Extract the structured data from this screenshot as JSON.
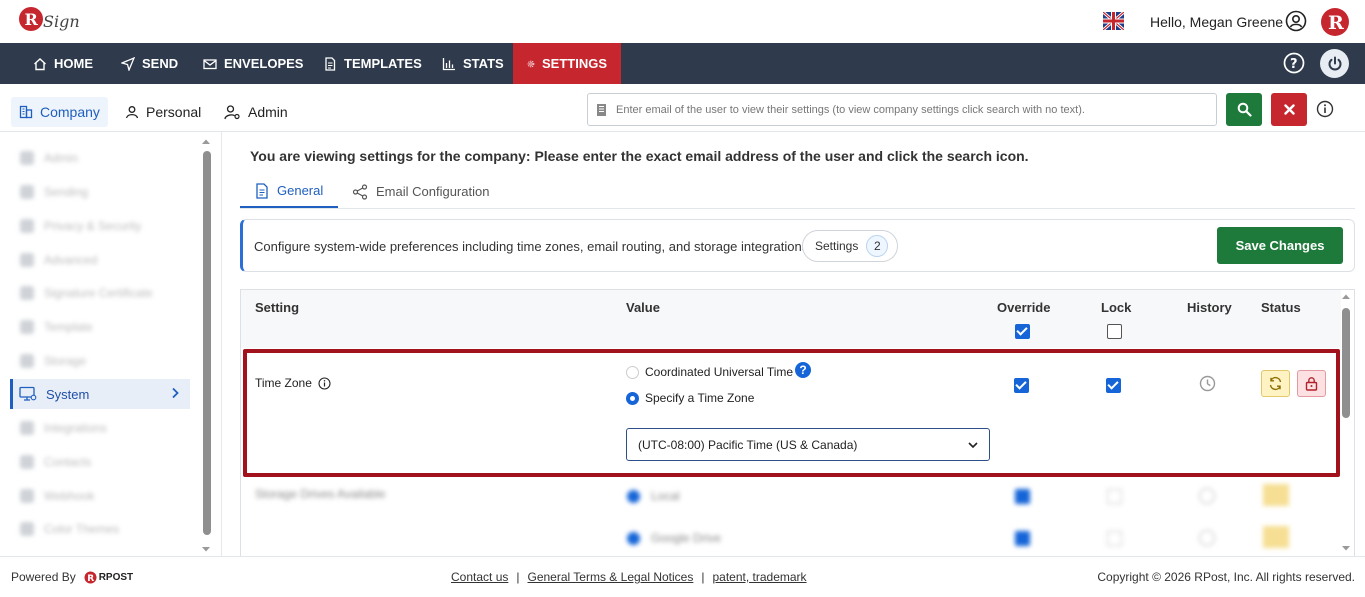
{
  "header": {
    "greeting": "Hello, Megan Greene",
    "brand_color": "#c6262e"
  },
  "nav": {
    "items": [
      {
        "label": "HOME",
        "icon": "home-icon"
      },
      {
        "label": "SEND",
        "icon": "send-icon"
      },
      {
        "label": "ENVELOPES",
        "icon": "envelope-icon"
      },
      {
        "label": "TEMPLATES",
        "icon": "document-icon"
      },
      {
        "label": "STATS",
        "icon": "bar-chart-icon"
      },
      {
        "label": "SETTINGS",
        "icon": "gear-icon",
        "active": true
      }
    ]
  },
  "subnav": {
    "tabs": [
      {
        "label": "Company",
        "active": true
      },
      {
        "label": "Personal"
      },
      {
        "label": "Admin"
      }
    ],
    "search_placeholder": "Enter email of the user to view their settings (to view company settings click search with no text)."
  },
  "sidebar": {
    "active_item": "System"
  },
  "main": {
    "notice": "You are viewing settings for the company: Please enter the exact email address of the user and click the search icon.",
    "tabs": [
      {
        "label": "General",
        "active": true
      },
      {
        "label": "Email Configuration"
      }
    ],
    "description": "Configure system-wide preferences including time zones, email routing, and storage integrations.",
    "settings_pill_label": "Settings",
    "settings_count": "2",
    "save_label": "Save Changes"
  },
  "table": {
    "headers": {
      "setting": "Setting",
      "value": "Value",
      "override": "Override",
      "lock": "Lock",
      "history": "History",
      "status": "Status"
    },
    "header_override_checked": true,
    "header_lock_checked": false,
    "row": {
      "setting": "Time Zone",
      "option_utc": "Coordinated Universal Time",
      "option_specify": "Specify a Time Zone",
      "selected_option": "Specify a Time Zone",
      "timezone_value": "(UTC-08:00) Pacific Time (US & Canada)",
      "override_checked": true,
      "lock_checked": true
    }
  },
  "footer": {
    "powered_by": "Powered By",
    "rpost": "RPOST",
    "links": [
      "Contact us",
      "General Terms & Legal Notices",
      "patent, trademark"
    ],
    "separator": "|",
    "copyright": "Copyright © 2026 RPost, Inc. All rights reserved."
  }
}
